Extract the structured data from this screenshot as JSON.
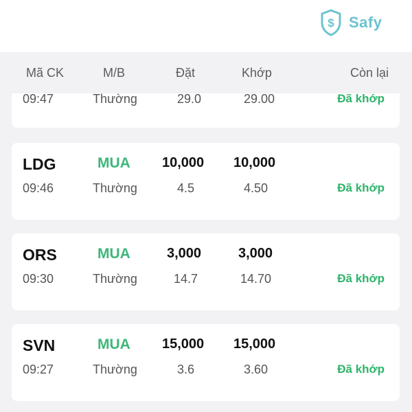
{
  "brand": {
    "name": "Safy",
    "color": "#6bc3cf"
  },
  "columns": {
    "symbol": "Mã CK",
    "side": "M/B",
    "ordered": "Đặt",
    "matched": "Khớp",
    "remaining": "Còn lại"
  },
  "colors": {
    "buy": "#3eb67a",
    "matched_status": "#2db36a"
  },
  "orders": [
    {
      "symbol": "",
      "side": "",
      "qty_ordered": "",
      "qty_matched": "",
      "time": "09:47",
      "type": "Thường",
      "price_ordered": "29.0",
      "price_matched": "29.00",
      "status": "Đã khớp"
    },
    {
      "symbol": "LDG",
      "side": "MUA",
      "qty_ordered": "10,000",
      "qty_matched": "10,000",
      "time": "09:46",
      "type": "Thường",
      "price_ordered": "4.5",
      "price_matched": "4.50",
      "status": "Đã khớp"
    },
    {
      "symbol": "ORS",
      "side": "MUA",
      "qty_ordered": "3,000",
      "qty_matched": "3,000",
      "time": "09:30",
      "type": "Thường",
      "price_ordered": "14.7",
      "price_matched": "14.70",
      "status": "Đã khớp"
    },
    {
      "symbol": "SVN",
      "side": "MUA",
      "qty_ordered": "15,000",
      "qty_matched": "15,000",
      "time": "09:27",
      "type": "Thường",
      "price_ordered": "3.6",
      "price_matched": "3.60",
      "status": "Đã khớp"
    }
  ]
}
